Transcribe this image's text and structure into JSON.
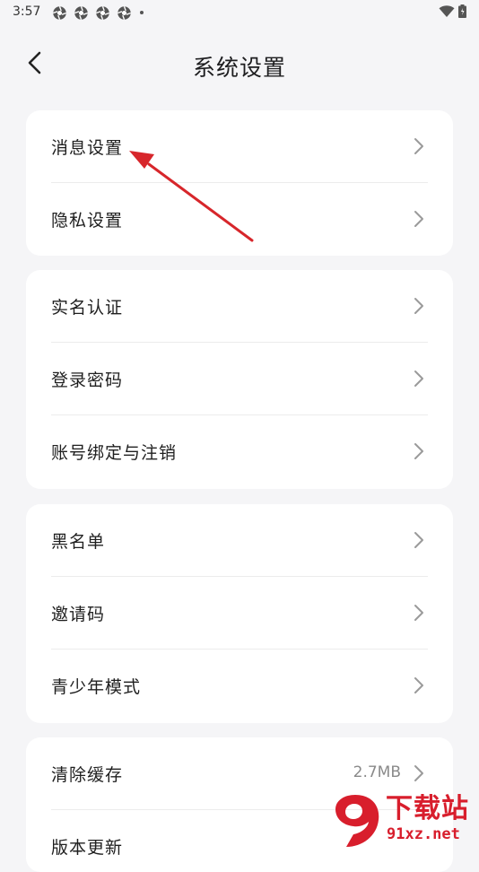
{
  "status_bar": {
    "time": "3:57",
    "app_icon": "aperture-icon",
    "overflow_dot": "dot-icon",
    "signal_icon": "wifi-icon",
    "battery_icon": "battery-icon"
  },
  "header": {
    "back_icon": "chevron-left-icon",
    "title": "系统设置"
  },
  "groups": [
    {
      "items": [
        {
          "label": "消息设置"
        },
        {
          "label": "隐私设置"
        }
      ]
    },
    {
      "items": [
        {
          "label": "实名认证"
        },
        {
          "label": "登录密码"
        },
        {
          "label": "账号绑定与注销"
        }
      ]
    },
    {
      "items": [
        {
          "label": "黑名单"
        },
        {
          "label": "邀请码"
        },
        {
          "label": "青少年模式"
        }
      ]
    },
    {
      "items": [
        {
          "label": "清除缓存",
          "value": "2.7MB"
        },
        {
          "label": "版本更新"
        }
      ]
    }
  ],
  "annotation": {
    "icon": "red-arrow-icon",
    "color": "#d7262b"
  },
  "watermark": {
    "brand": "下载站",
    "site": "91xz.net",
    "color": "#d81e2c"
  },
  "colors": {
    "background": "#f5f5f7",
    "card": "#ffffff",
    "text": "#1f1f1f",
    "secondary": "#8a8a8a"
  }
}
